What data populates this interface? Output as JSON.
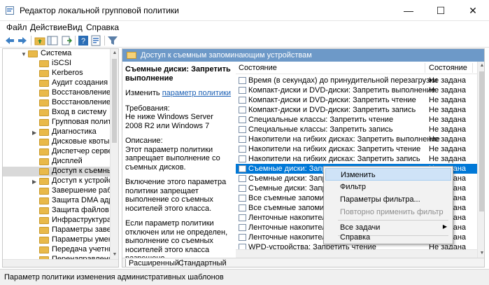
{
  "window": {
    "title": "Редактор локальной групповой политики",
    "minimize_icon": "minimize-icon",
    "maximize_icon": "maximize-icon",
    "close_icon": "close-icon"
  },
  "menu": [
    "Файл",
    "Действие",
    "Вид",
    "Справка"
  ],
  "toolbar": [
    "back-arrow-icon",
    "forward-arrow-icon",
    "folder-up-icon",
    "show-hide-tree-icon",
    "export-list-icon",
    "help-icon",
    "properties-icon",
    "filter-icon"
  ],
  "tree": {
    "items": [
      {
        "label": "Система",
        "expanded": true
      },
      {
        "label": "iSCSI"
      },
      {
        "label": "Kerberos"
      },
      {
        "label": "Аудит создания пр"
      },
      {
        "label": "Восстановление"
      },
      {
        "label": "Восстановление си"
      },
      {
        "label": "Вход в систему"
      },
      {
        "label": "Групповая полити"
      },
      {
        "label": "Диагностика"
      },
      {
        "label": "Дисковые квоты"
      },
      {
        "label": "Диспетчер сервера"
      },
      {
        "label": "Дисплей"
      },
      {
        "label": "Доступ к съемны",
        "selected": true
      },
      {
        "label": "Доступ к устройств"
      },
      {
        "label": "Завершение работ"
      },
      {
        "label": "Защита DMA адра"
      },
      {
        "label": "Защита файлов W"
      },
      {
        "label": "Инфраструктура к"
      },
      {
        "label": "Параметры завер"
      },
      {
        "label": "Параметры умень"
      },
      {
        "label": "Передача учетных"
      },
      {
        "label": "Перенаправление"
      },
      {
        "label": "Питание ОС"
      }
    ]
  },
  "panel": {
    "header": "Доступ к съемным запоминающим устройствам",
    "ext": {
      "title": "Съемные диски: Запретить выполнение",
      "edit_prefix": "Изменить",
      "edit_link": "параметр политики",
      "req_label": "Требования:",
      "req_text": "Не ниже Windows Server 2008 R2 или Windows 7",
      "desc_label": "Описание:",
      "desc1": "Этот параметр политики запрещает выполнение со съемных дисков.",
      "desc2": "Включение этого параметра политики запрещает выполнение со съемных носителей этого класса.",
      "desc3": "Если параметр политики отключен или не определен, выполнение со съемных носителей этого класса разрешено."
    },
    "columns": {
      "name": "Состояние",
      "state": "Состояние"
    },
    "rows": [
      {
        "name": "Время (в секундах) до принудительной перезагрузки",
        "state": "Не задана"
      },
      {
        "name": "Компакт-диски и DVD-диски: Запретить выполнение",
        "state": "Не задана"
      },
      {
        "name": "Компакт-диски и DVD-диски: Запретить чтение",
        "state": "Не задана"
      },
      {
        "name": "Компакт-диски и DVD-диски: Запретить запись",
        "state": "Не задана"
      },
      {
        "name": "Специальные классы: Запретить чтение",
        "state": "Не задана"
      },
      {
        "name": "Специальные классы: Запретить запись",
        "state": "Не задана"
      },
      {
        "name": "Накопители на гибких дисках: Запретить выполнение",
        "state": "Не задана"
      },
      {
        "name": "Накопители на гибких дисках: Запретить чтение",
        "state": "Не задана"
      },
      {
        "name": "Накопители на гибких дисках: Запретить запись",
        "state": "Не задана"
      },
      {
        "name": "Съемные диски: Запретить",
        "state": "Не задана",
        "selected": true
      },
      {
        "name": "Съемные диски: Запретить",
        "state": "Не задана"
      },
      {
        "name": "Съемные диски: Запретить",
        "state": "Не задана"
      },
      {
        "name": "Все съемные запоминающ",
        "state": "Не задана"
      },
      {
        "name": "Все съемные запоминающ",
        "state": "Не задана"
      },
      {
        "name": "Ленточные накопители: За",
        "state": "Не задана"
      },
      {
        "name": "Ленточные накопители: За",
        "state": "Не задана"
      },
      {
        "name": "Ленточные накопители: За",
        "state": "Не задана"
      },
      {
        "name": "WPD-устройства: Запретить чтение",
        "state": "Не задана"
      }
    ],
    "tabs": [
      "Расширенный",
      "Стандартный"
    ]
  },
  "context_menu": {
    "items": [
      {
        "label": "Изменить",
        "hover": true
      },
      {
        "label": "Фильтр"
      },
      {
        "label": "Параметры фильтра..."
      },
      {
        "label": "Повторно применить фильтр",
        "disabled": true
      },
      {
        "label": "Все задачи",
        "submenu": true
      },
      {
        "label": "Справка"
      }
    ]
  },
  "status": "Параметр политики изменения административных шаблонов",
  "colors": {
    "header_bg": "#6d99c8",
    "selection": "#0078d7",
    "folder": "#e9b949"
  }
}
